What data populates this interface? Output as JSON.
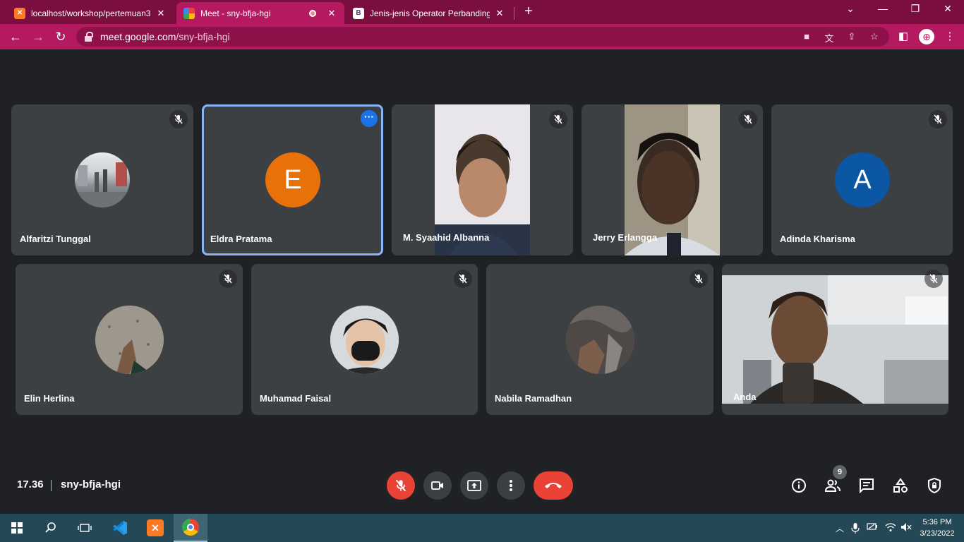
{
  "browser": {
    "tabs": [
      {
        "title": "localhost/workshop/pertemuan3"
      },
      {
        "title": "Meet - sny-bfja-hgi"
      },
      {
        "title": "Jenis-jenis Operator Perbandingan"
      }
    ],
    "url_host": "meet.google.com",
    "url_path": "/sny-bfja-hgi"
  },
  "participants_row1": [
    {
      "name": "Alfaritzi Tunggal"
    },
    {
      "name": "Eldra Pratama",
      "initial": "E",
      "color": "#e8710a"
    },
    {
      "name": "M. Syaahid Albanna"
    },
    {
      "name": "Jerry Erlangga"
    },
    {
      "name": "Adinda Kharisma",
      "initial": "A",
      "color": "#0b57a4"
    }
  ],
  "participants_row2": [
    {
      "name": "Elin Herlina"
    },
    {
      "name": "Muhamad Faisal"
    },
    {
      "name": "Nabila Ramadhan"
    },
    {
      "name": "Anda"
    }
  ],
  "bottom": {
    "time": "17.36",
    "meeting_code": "sny-bfja-hgi",
    "participant_count": "9"
  },
  "taskbar": {
    "time": "5:36 PM",
    "date": "3/23/2022"
  },
  "colors": {
    "accent_red": "#ea4335",
    "selected_outline": "#8ab4f8",
    "chrome_theme": "#b5195f"
  }
}
